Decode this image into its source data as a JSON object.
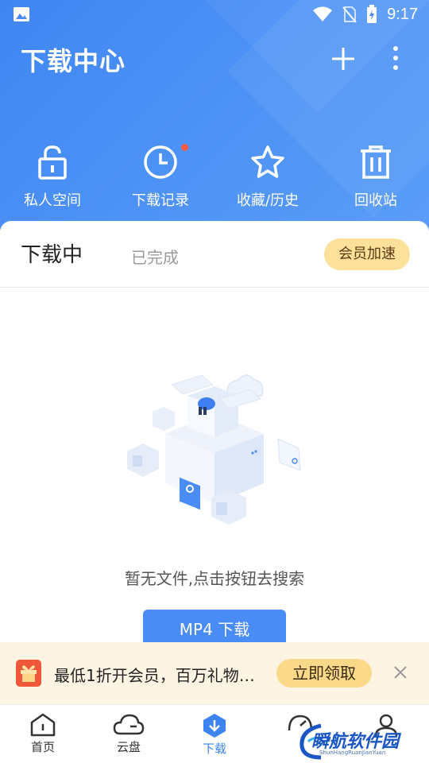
{
  "status_bar": {
    "time": "9:17"
  },
  "header": {
    "title": "下载中心",
    "quick_actions": [
      {
        "label": "私人空间",
        "icon": "lock-icon"
      },
      {
        "label": "下载记录",
        "icon": "clock-icon"
      },
      {
        "label": "收藏/历史",
        "icon": "star-icon"
      },
      {
        "label": "回收站",
        "icon": "trash-icon"
      }
    ]
  },
  "tabs": {
    "downloading": "下载中",
    "completed": "已完成",
    "vip_boost": "会员加速"
  },
  "empty_state": {
    "message": "暂无文件,点击按钮去搜索",
    "button": "MP4 下载"
  },
  "promo": {
    "text": "最低1折开会员，百万礼物…",
    "claim": "立即领取"
  },
  "bottom_nav": [
    {
      "label": "首页",
      "icon": "home-icon"
    },
    {
      "label": "云盘",
      "icon": "cloud-icon"
    },
    {
      "label": "下载",
      "icon": "download-icon"
    }
  ],
  "watermark": {
    "text": "瞬航软件园",
    "sub": "ShunHangRuanJianYuan"
  },
  "colors": {
    "primary": "#3f86f2",
    "vip": "#fbe19a",
    "promo_bg": "#fdf4e3",
    "dot": "#ff5a4a"
  }
}
